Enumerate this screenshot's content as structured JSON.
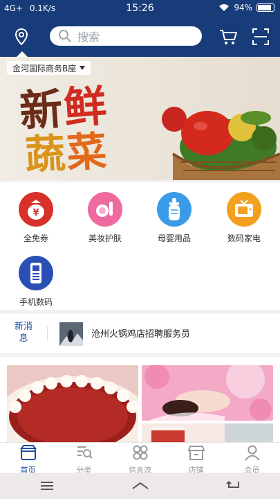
{
  "status_bar": {
    "network": "4G+",
    "speed": "0.1K/s",
    "time": "15:26",
    "battery": "94%"
  },
  "header": {
    "search_placeholder": "搜索",
    "location_label": "金河国际商务B座"
  },
  "banner": {
    "title_line1_a": "新",
    "title_line1_b": "鲜",
    "title_line2_a": "蔬",
    "title_line2_b": "菜"
  },
  "categories": [
    {
      "label": "全免券",
      "icon": "money-bag-icon",
      "color": "#d8302a"
    },
    {
      "label": "美妆护肤",
      "icon": "cosmetics-icon",
      "color": "#ee6a9f"
    },
    {
      "label": "母婴用品",
      "icon": "baby-bottle-icon",
      "color": "#3a9ce8"
    },
    {
      "label": "数码家电",
      "icon": "tv-icon",
      "color": "#f2a01e"
    },
    {
      "label": "手机数码",
      "icon": "phone-icon",
      "color": "#2a4fb5"
    }
  ],
  "news": {
    "tag": "新消息",
    "text": "沧州火锅鸡店招聘服务员"
  },
  "tabbar": [
    {
      "label": "首页",
      "icon": "home-icon",
      "active": true
    },
    {
      "label": "分类",
      "icon": "category-icon",
      "active": false
    },
    {
      "label": "信息流",
      "icon": "feed-icon",
      "active": false
    },
    {
      "label": "店铺",
      "icon": "store-icon",
      "active": false
    },
    {
      "label": "会员",
      "icon": "member-icon",
      "active": false
    }
  ],
  "colors": {
    "header_bg": "#183c7a",
    "accent": "#1f4fa0"
  }
}
